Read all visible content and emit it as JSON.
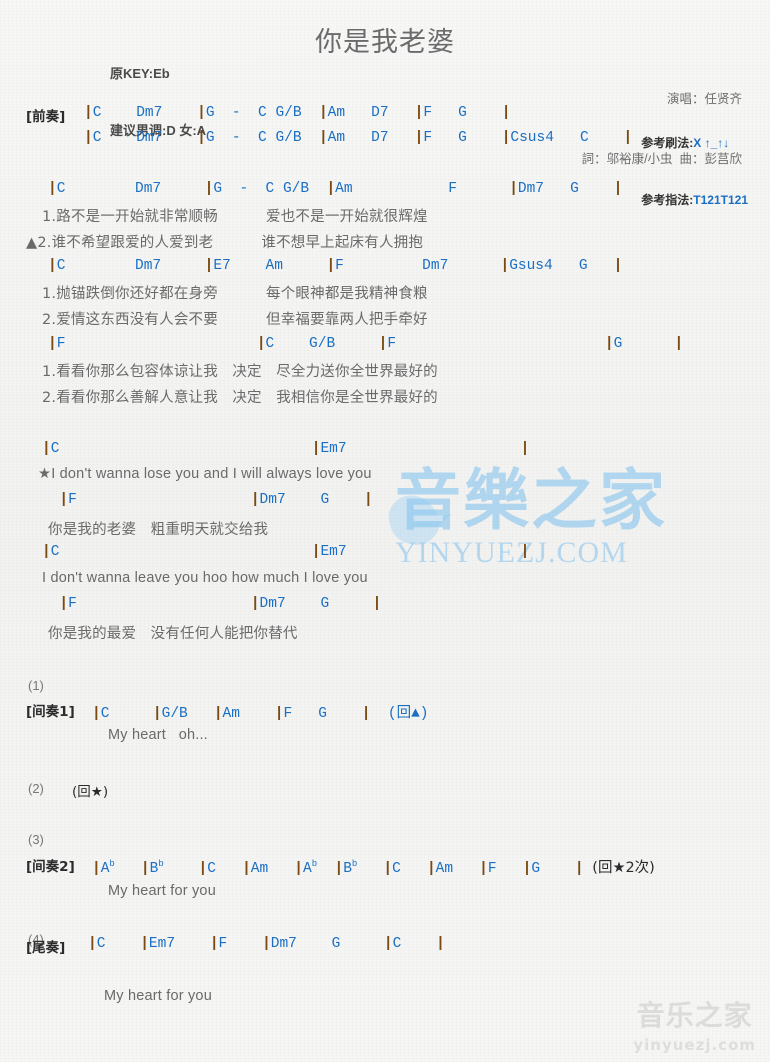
{
  "header": {
    "orig_key": "原KEY:Eb",
    "suggest_key": "建议男调:D 女:A",
    "title": "你是我老婆",
    "singer": "演唱：任贤齐",
    "writer": "詞：邬裕康/小虫  曲：彭莒欣",
    "strum_label": "参考刷法:",
    "strum_value": "X ↑_↑↓",
    "finger_label": "参考指法:",
    "finger_value": "T121T121"
  },
  "sections": {
    "intro_tag": "[前奏]",
    "intro_line1": "|C    Dm7    |G  -  C G/B  |Am   D7   |F   G    |",
    "intro_line2": "|C    Dm7    |G  -  C G/B  |Am   D7   |F   G    |Csus4   C    |",
    "verse1_chords": "|C        Dm7     |G  -  C G/B  |Am           F      |Dm7   G    |",
    "verse1_lyric1": "1.路不是一开始就非常顺畅          爱也不是一开始就很辉煌",
    "verse1_lyric2": "▲2.谁不希望跟爱的人爱到老          谁不想早上起床有人拥抱",
    "verse2_chords": "|C        Dm7     |E7    Am     |F         Dm7      |Gsus4   G   |",
    "verse2_lyric1": "1.抛锚跌倒你还好都在身旁          每个眼神都是我精神食粮",
    "verse2_lyric2": "2.爱情这东西没有人会不要          但幸福要靠两人把手牵好",
    "verse3_chords": "|F                      |C    G/B     |F                        |G      |",
    "verse3_lyric1": "1.看看你那么包容体谅让我   决定   尽全力送你全世界最好的",
    "verse3_lyric2": "2.看看你那么善解人意让我   决定   我相信你是全世界最好的",
    "chorus1_chords": "|C                             |Em7                    |",
    "chorus1_lyric": "★I don't wanna lose you and I will always love you",
    "chorus2_chords": "  |F                    |Dm7    G    |",
    "chorus2_lyric": "你是我的老婆   粗重明天就交给我",
    "chorus3_chords": "|C                             |Em7                    |",
    "chorus3_lyric": "I don't wanna leave you hoo how much I love you",
    "chorus4_chords": "  |F                    |Dm7    G     |",
    "chorus4_lyric": "你是我的最爱   没有任何人能把你替代",
    "num1": "(1)",
    "inter1_tag": "[间奏1]",
    "inter1_chords": "|C     |G/B   |Am    |F   G    |  (回▲)",
    "inter1_lyric": "My heart   oh...",
    "num2": "(2)",
    "repeat_star": "(回★)",
    "num3": "(3)",
    "inter2_tag": "[间奏2]",
    "inter2_chords_plain": "|Ab   |Bb    |C   |Am   |Ab   |Bb   |C   |Am   |F   |G    | (回★2次)",
    "inter2_lyric": "My heart for you",
    "num4": "(4)",
    "outro_tag": "[尾奏]",
    "outro_chords": "|C    |Em7    |F    |Dm7    G     |C    |",
    "outro_lyric": "My heart for you"
  },
  "watermark": {
    "center_cn": "音樂之家",
    "center_domain": "YINYUEZJ.COM",
    "bottom_cn": "音乐之家",
    "bottom_domain": "yinyuezj.com"
  },
  "colors": {
    "chord": "#1a6fc4",
    "barline": "#7a4a12",
    "lyric": "#6a6a6a",
    "tag": "#2b2b2b",
    "watermark_blue": "#89c6ef"
  }
}
